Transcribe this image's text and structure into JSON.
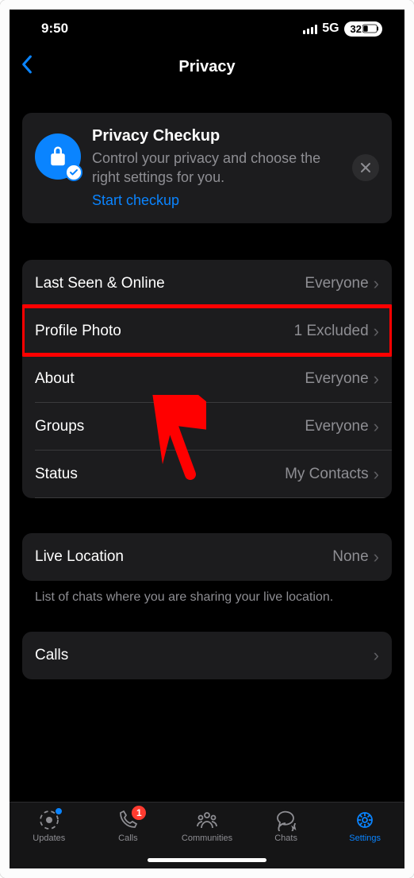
{
  "statusBar": {
    "time": "9:50",
    "network": "5G",
    "battery": "32"
  },
  "header": {
    "title": "Privacy"
  },
  "checkupCard": {
    "title": "Privacy Checkup",
    "description": "Control your privacy and choose the right settings for you.",
    "link": "Start checkup"
  },
  "privacyGroup": [
    {
      "label": "Last Seen & Online",
      "value": "Everyone"
    },
    {
      "label": "Profile Photo",
      "value": "1 Excluded"
    },
    {
      "label": "About",
      "value": "Everyone"
    },
    {
      "label": "Groups",
      "value": "Everyone"
    },
    {
      "label": "Status",
      "value": "My Contacts"
    }
  ],
  "liveLocation": {
    "label": "Live Location",
    "value": "None",
    "footer": "List of chats where you are sharing your live location."
  },
  "calls": {
    "label": "Calls"
  },
  "tabs": [
    {
      "label": "Updates",
      "icon": "updates",
      "dot": true
    },
    {
      "label": "Calls",
      "icon": "calls",
      "badge": "1"
    },
    {
      "label": "Communities",
      "icon": "communities"
    },
    {
      "label": "Chats",
      "icon": "chats"
    },
    {
      "label": "Settings",
      "icon": "settings",
      "active": true
    }
  ]
}
